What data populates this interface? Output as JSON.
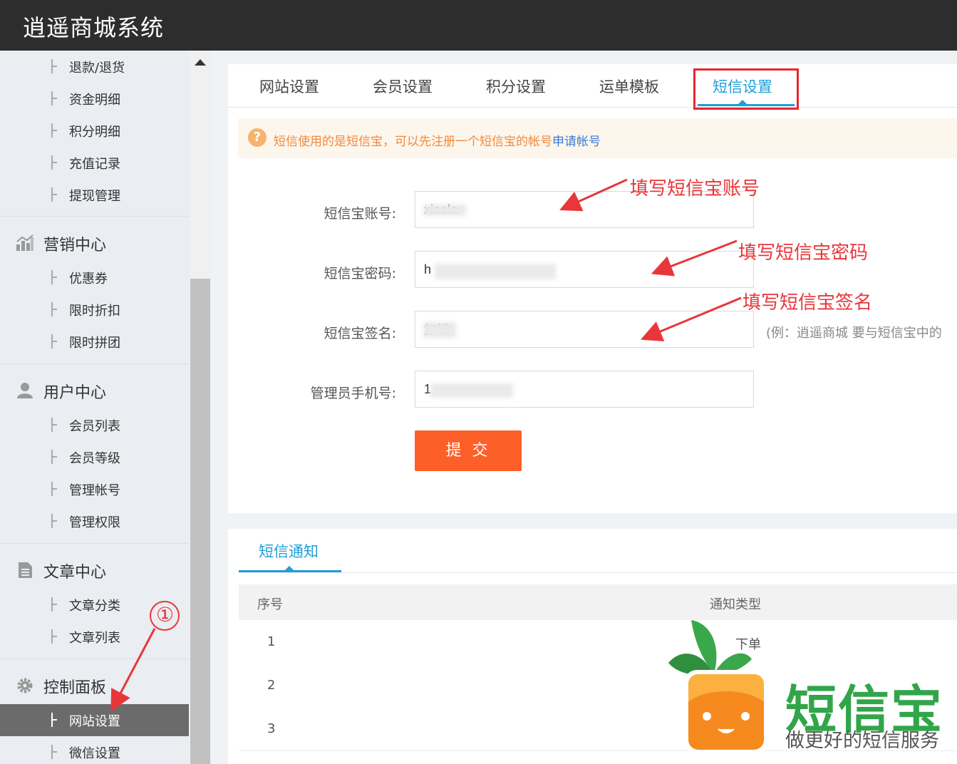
{
  "app": {
    "title": "逍遥商城系统"
  },
  "sidebar": {
    "finance_items": [
      "退款/退货",
      "资金明细",
      "积分明细",
      "充值记录",
      "提现管理"
    ],
    "sections": [
      {
        "label": "营销中心",
        "icon": "chart-icon",
        "items": [
          "优惠券",
          "限时折扣",
          "限时拼团"
        ]
      },
      {
        "label": "用户中心",
        "icon": "user-icon",
        "items": [
          "会员列表",
          "会员等级",
          "管理帐号",
          "管理权限"
        ]
      },
      {
        "label": "文章中心",
        "icon": "document-icon",
        "items": [
          "文章分类",
          "文章列表"
        ]
      },
      {
        "label": "控制面板",
        "icon": "gear-icon",
        "items": [
          "网站设置",
          "微信设置"
        ]
      }
    ],
    "active_item": "网站设置"
  },
  "tabs": [
    "网站设置",
    "会员设置",
    "积分设置",
    "运单模板",
    "短信设置"
  ],
  "active_tab": "短信设置",
  "notice": {
    "text": "短信使用的是短信宝，可以先注册一个短信宝的帐号",
    "link": "申请帐号"
  },
  "form": {
    "account_label": "短信宝账号:",
    "account_value": "xiaola",
    "password_label": "短信宝密码:",
    "password_value": "h",
    "signature_label": "短信宝签名:",
    "signature_value": "加锁",
    "signature_hint": "(例：逍遥商城 要与短信宝中的",
    "phone_label": "管理员手机号:",
    "phone_value": "1",
    "submit": "提 交"
  },
  "annotations": {
    "account": "填写短信宝账号",
    "password": "填写短信宝密码",
    "signature": "填写短信宝签名",
    "step": "①"
  },
  "notify": {
    "tab": "短信通知",
    "headers": [
      "序号",
      "通知类型"
    ],
    "rows": [
      {
        "index": "1",
        "type": "下单"
      },
      {
        "index": "2",
        "type": ""
      },
      {
        "index": "3",
        "type": ""
      }
    ]
  },
  "watermark": {
    "name": "短信宝",
    "slogan": "做更好的短信服务"
  },
  "colors": {
    "accent": "#1e9fd7",
    "submit": "#fd5f29",
    "annotation": "#e8363a",
    "brand_green": "#32a54a"
  }
}
